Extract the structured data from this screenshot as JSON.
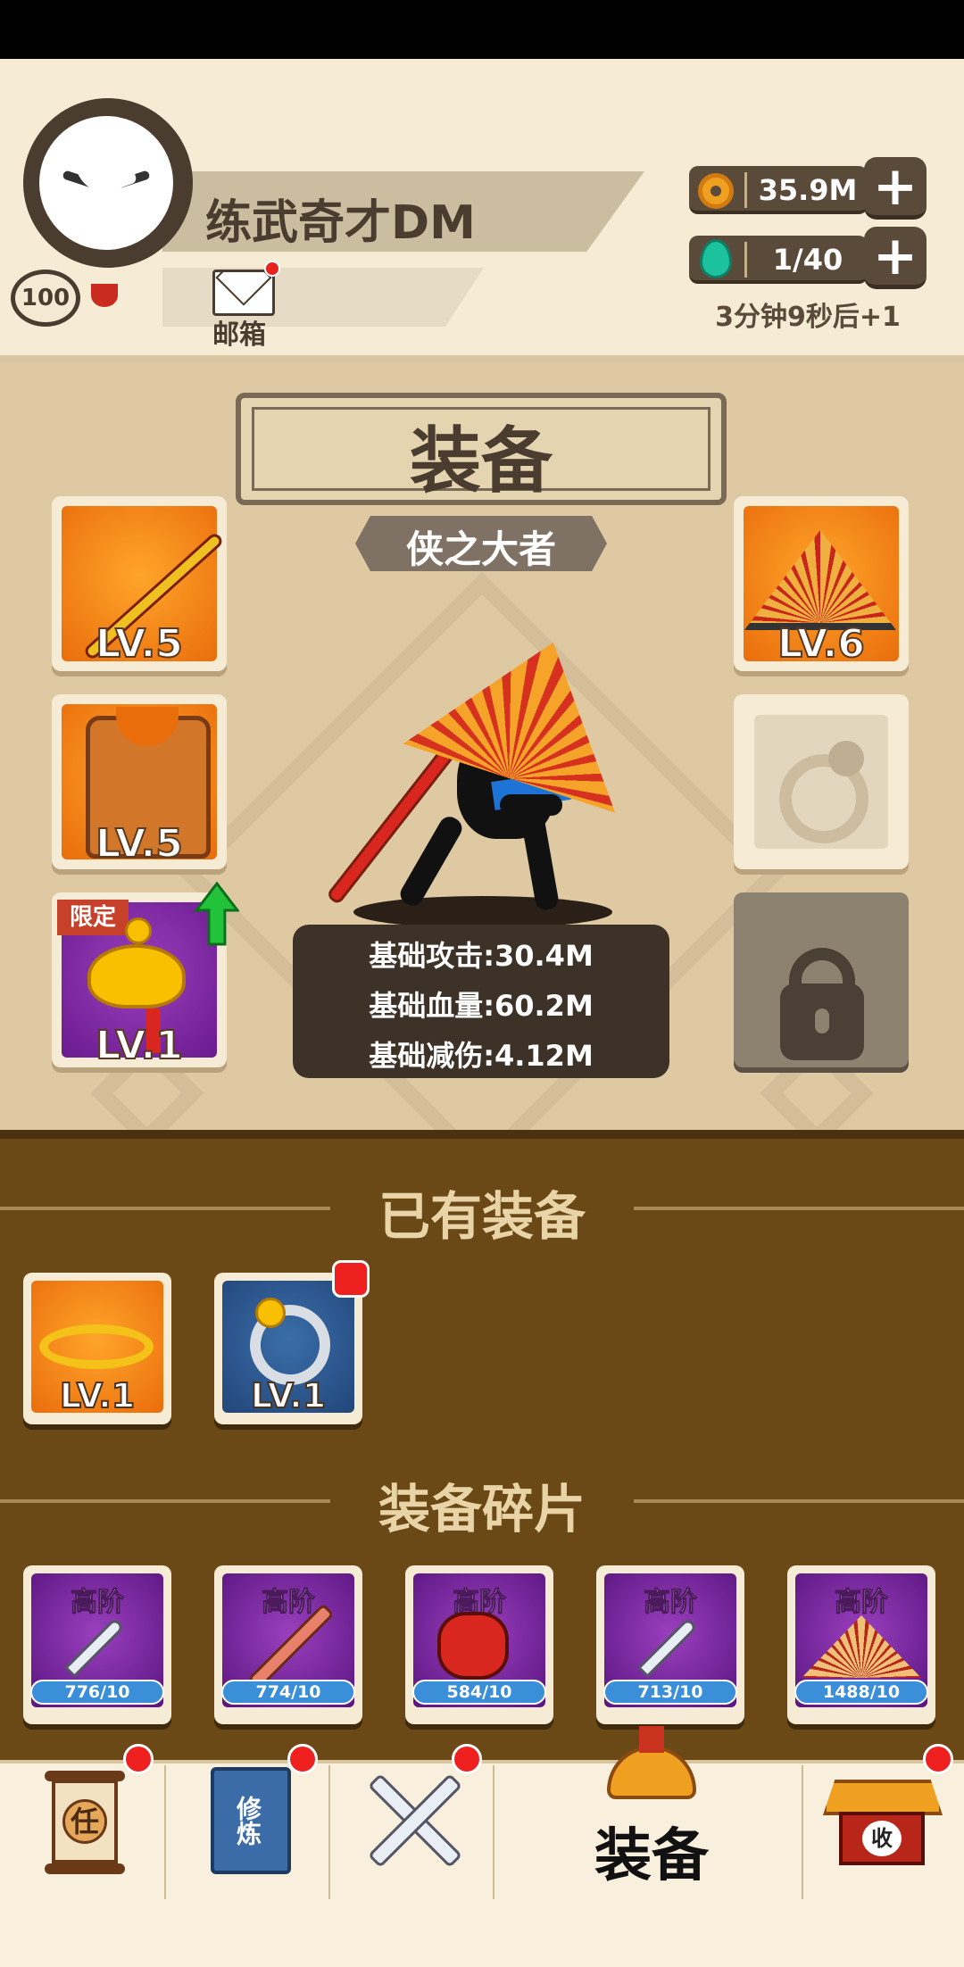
{
  "player": {
    "name": "练武奇才DM",
    "level": "100",
    "mail_label": "邮箱"
  },
  "resources": {
    "coins": "35.9M",
    "stamina": "1/40",
    "timer": "3分钟9秒后+1"
  },
  "equipment": {
    "title": "装备",
    "rank_title": "侠之大者",
    "limited_tag": "限定",
    "slots": [
      {
        "name": "staff",
        "level": "LV.5"
      },
      {
        "name": "armor-vest",
        "level": "LV.5"
      },
      {
        "name": "gold-ingot-pendant",
        "level": "LV.1"
      },
      {
        "name": "straw-hat",
        "level": "LV.6"
      },
      {
        "name": "ring-empty",
        "level": ""
      },
      {
        "name": "locked",
        "level": ""
      }
    ],
    "stats": {
      "attack": "基础攻击:30.4M",
      "health": "基础血量:60.2M",
      "damage_reduction": "基础减伤:4.12M"
    }
  },
  "inventory": {
    "owned_title": "已有装备",
    "owned": [
      {
        "name": "gold-headband",
        "level": "LV.1"
      },
      {
        "name": "silver-ring",
        "level": "LV.1"
      }
    ],
    "fragments_title": "装备碎片",
    "fragments": [
      {
        "tier": "高阶",
        "count": "776/10",
        "item": "saber"
      },
      {
        "tier": "高阶",
        "count": "774/10",
        "item": "sword"
      },
      {
        "tier": "高阶",
        "count": "584/10",
        "item": "gauntlet"
      },
      {
        "tier": "高阶",
        "count": "713/10",
        "item": "saber"
      },
      {
        "tier": "高阶",
        "count": "1488/10",
        "item": "hat"
      }
    ]
  },
  "nav": {
    "items": [
      {
        "icon": "quest-scroll-icon",
        "text": "任"
      },
      {
        "icon": "training-book-icon",
        "text": "修炼"
      },
      {
        "icon": "crossed-swords-icon",
        "text": ""
      },
      {
        "icon": "armor-icon",
        "label": "装备"
      },
      {
        "icon": "collection-temple-icon",
        "text": "收"
      }
    ]
  },
  "colors": {
    "panel": "#dfc9a2",
    "inventory_bg": "#6a4917",
    "header_bg": "#f6ebd4",
    "badge_red": "#ee2020"
  }
}
